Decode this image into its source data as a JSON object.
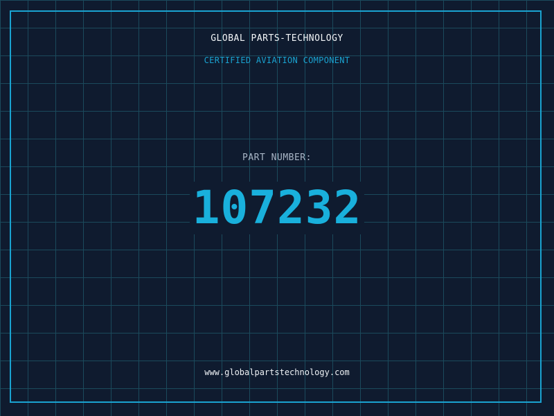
{
  "header": {
    "company_name": "GLOBAL PARTS-TECHNOLOGY",
    "subtitle": "CERTIFIED AVIATION COMPONENT"
  },
  "part": {
    "label": "PART NUMBER:",
    "number": "107232"
  },
  "footer": {
    "website": "www.globalpartstechnology.com"
  },
  "colors": {
    "background": "#0f1b2f",
    "grid": "#1b4a5c",
    "accent": "#1aa3d1",
    "text_primary": "#f2f5f7",
    "text_muted": "#a9b6c6"
  }
}
